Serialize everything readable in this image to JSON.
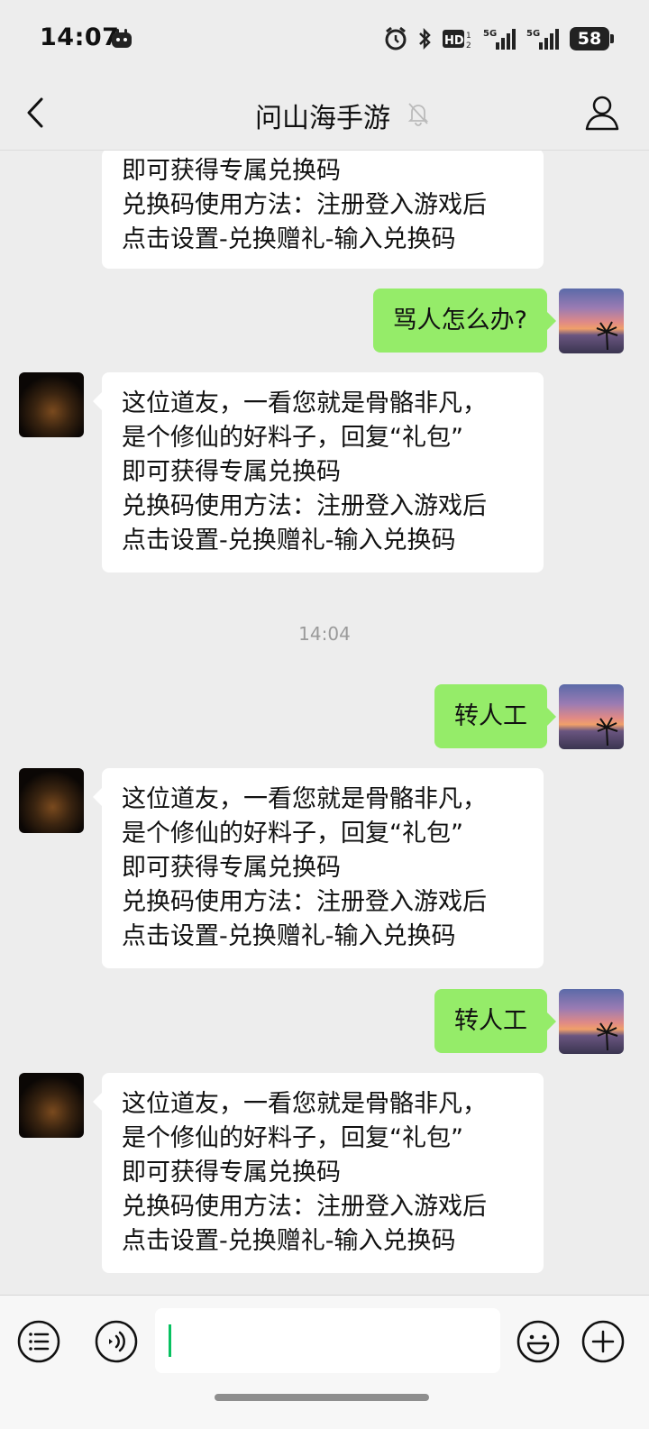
{
  "status_bar": {
    "time": "14:07",
    "battery_level": "58",
    "icons": [
      "app-notification-icon",
      "alarm-icon",
      "bluetooth-icon",
      "hd-icon",
      "5g-signal-icon",
      "5g-signal-icon",
      "battery-icon"
    ]
  },
  "nav": {
    "title": "问山海手游",
    "muted": true,
    "back_icon": "chevron-left-icon",
    "profile_icon": "person-icon"
  },
  "chat": {
    "messages": [
      {
        "from": "bot",
        "text": "即可获得专属兑换码\n兑换码使用方法：注册登入游戏后\n点击设置-兑换赠礼-输入兑换码"
      },
      {
        "from": "me",
        "text": "骂人怎么办?"
      },
      {
        "from": "bot",
        "text": "这位道友，一看您就是骨骼非凡，\n是个修仙的好料子，回复“礼包”\n即可获得专属兑换码\n兑换码使用方法：注册登入游戏后\n点击设置-兑换赠礼-输入兑换码"
      },
      {
        "from": "system",
        "text": "14:04"
      },
      {
        "from": "me",
        "text": "转人工"
      },
      {
        "from": "bot",
        "text": "这位道友，一看您就是骨骼非凡，\n是个修仙的好料子，回复“礼包”\n即可获得专属兑换码\n兑换码使用方法：注册登入游戏后\n点击设置-兑换赠礼-输入兑换码"
      },
      {
        "from": "me",
        "text": "转人工"
      },
      {
        "from": "bot",
        "text": "这位道友，一看您就是骨骼非凡，\n是个修仙的好料子，回复“礼包”\n即可获得专属兑换码\n兑换码使用方法：注册登入游戏后\n点击设置-兑换赠礼-输入兑换码"
      }
    ]
  },
  "input_bar": {
    "text_value": "",
    "icons": [
      "menu-list-icon",
      "voice-icon",
      "emoji-icon",
      "plus-icon"
    ]
  },
  "colors": {
    "background": "#ededed",
    "outgoing_bubble": "#95ec69",
    "incoming_bubble": "#ffffff",
    "caret": "#07c160"
  }
}
